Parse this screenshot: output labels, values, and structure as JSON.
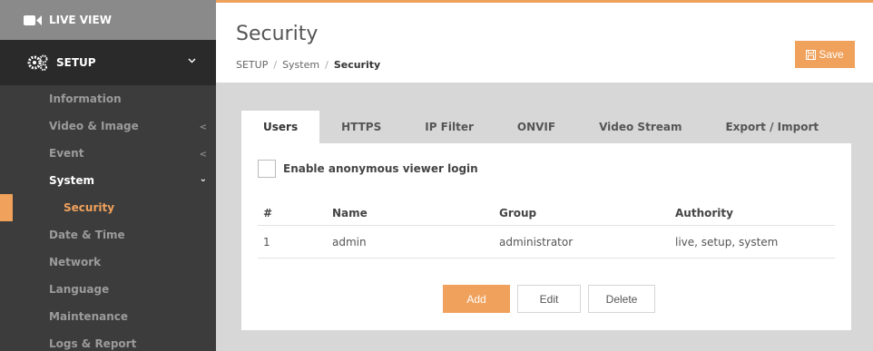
{
  "sidebar": {
    "live_view": "LIVE VIEW",
    "setup": "SETUP",
    "items": [
      {
        "label": "Information",
        "arrow": ""
      },
      {
        "label": "Video & Image",
        "arrow": "<"
      },
      {
        "label": "Event",
        "arrow": "<"
      },
      {
        "label": "System",
        "arrow": "⌄"
      },
      {
        "label": "Security",
        "arrow": ""
      },
      {
        "label": "Date & Time",
        "arrow": ""
      },
      {
        "label": "Network",
        "arrow": ""
      },
      {
        "label": "Language",
        "arrow": ""
      },
      {
        "label": "Maintenance",
        "arrow": ""
      },
      {
        "label": "Logs & Report",
        "arrow": ""
      }
    ]
  },
  "header": {
    "title": "Security",
    "breadcrumb": [
      "SETUP",
      "System",
      "Security"
    ],
    "save_label": "Save"
  },
  "tabs": [
    "Users",
    "HTTPS",
    "IP Filter",
    "ONVIF",
    "Video Stream",
    "Export / Import"
  ],
  "anonymous_login": {
    "label": "Enable anonymous viewer login",
    "checked": false
  },
  "users_table": {
    "headers": [
      "#",
      "Name",
      "Group",
      "Authority"
    ],
    "rows": [
      [
        "1",
        "admin",
        "administrator",
        "live, setup, system"
      ]
    ]
  },
  "buttons": {
    "add": "Add",
    "edit": "Edit",
    "delete": "Delete"
  },
  "colors": {
    "accent": "#f0a15c",
    "sidebar_bg": "#3c3c3c",
    "content_bg": "#d7d7d7"
  }
}
